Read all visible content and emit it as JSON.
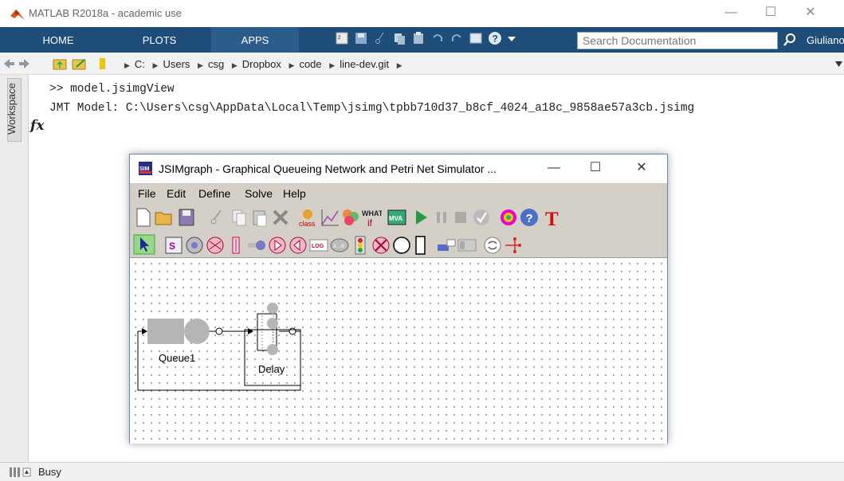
{
  "app": {
    "title": "MATLAB R2018a - academic use"
  },
  "ribbon": {
    "tabs": [
      "HOME",
      "PLOTS",
      "APPS"
    ],
    "search_placeholder": "Search Documentation",
    "user": "Giuliano"
  },
  "path": {
    "crumbs": [
      "C:",
      "Users",
      "csg",
      "Dropbox",
      "code",
      "line-dev.git"
    ]
  },
  "workspace": {
    "label": "Workspace"
  },
  "command_window": {
    "fx": "fx",
    "lines": [
      ">> model.jsimgView",
      "JMT Model: C:\\Users\\csg\\AppData\\Local\\Temp\\jsimg\\tpbb710d37_b8cf_4024_a18c_9858ae57a3cb.jsimg"
    ]
  },
  "status": {
    "text": "Busy"
  },
  "jsim": {
    "title": "JSIMgraph - Graphical Queueing Network and Petri Net Simulator ...",
    "menu": [
      "File",
      "Edit",
      "Define",
      "Solve",
      "Help"
    ],
    "toolbar_icons": [
      "new-file",
      "open-folder",
      "save",
      "cut",
      "copy",
      "paste",
      "delete",
      "class",
      "graph",
      "palette",
      "what-if",
      "mva",
      "run",
      "pause",
      "stop",
      "check",
      "wizard",
      "help",
      "text-tool"
    ],
    "palette_icons": [
      "select-arrow",
      "source",
      "sink",
      "router",
      "fork",
      "queue",
      "delay",
      "logger",
      "place",
      "join",
      "semaphore",
      "transition",
      "circle",
      "rectangle",
      "fcr-region",
      "bar",
      "scaler",
      "reconnect"
    ],
    "node_labels": {
      "queue": "Queue1",
      "delay": "Delay"
    },
    "colors": {
      "node_fill": "#b5b5b5",
      "title_text": "#000000"
    }
  }
}
